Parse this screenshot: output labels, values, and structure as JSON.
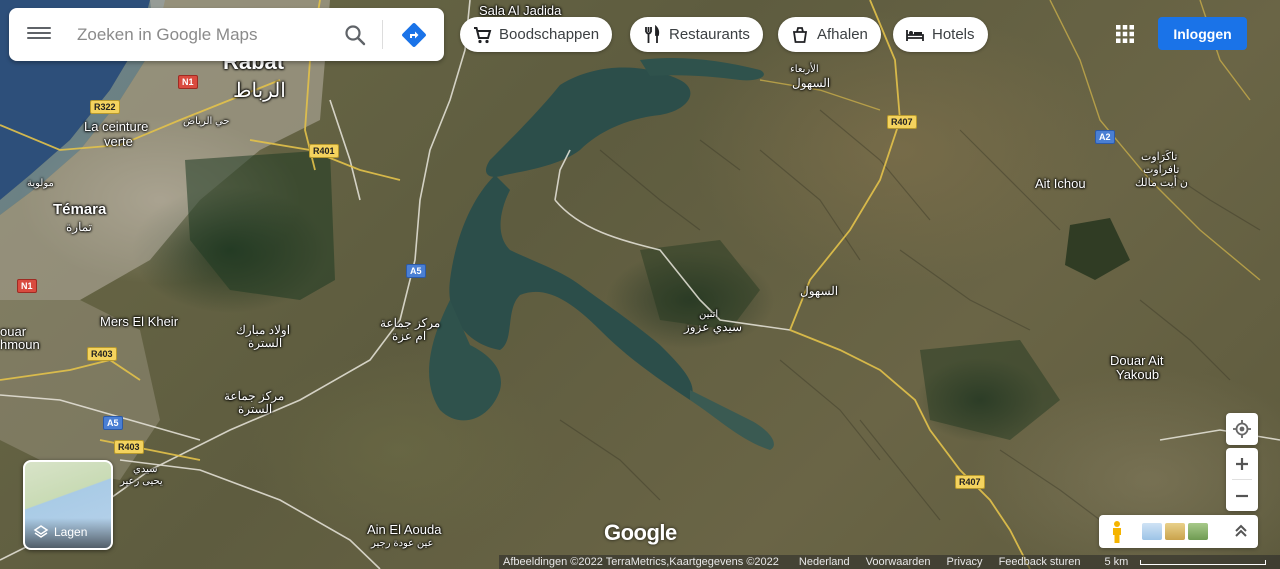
{
  "search": {
    "placeholder": "Zoeken in Google Maps"
  },
  "chips": [
    {
      "label": "Boodschappen",
      "icon": "cart-icon"
    },
    {
      "label": "Restaurants",
      "icon": "fork-knife-icon"
    },
    {
      "label": "Afhalen",
      "icon": "takeout-icon"
    },
    {
      "label": "Hotels",
      "icon": "bed-icon"
    }
  ],
  "login_label": "Inloggen",
  "layers_label": "Lagen",
  "logo": "Google",
  "places": {
    "sala_al_jadida": "Sala Al Jadida",
    "rabat": "Rabat",
    "rabat_ar": "الرباط",
    "la_ceinture": "La ceinture",
    "verte": "verte",
    "hay_riad_ar": "حي الرياض",
    "temara": "Témara",
    "temara_ar": "تمارة",
    "mers_el_kheir": "Mers El Kheir",
    "ouled_mbarek_ar": "اولاد مبارك",
    "ouled_mbarek_ar2": "السترة",
    "markaz_ar": "مركز جماعة",
    "markaz_ar2": "ام عزة",
    "markaz2_ar": "مركز جماعة",
    "markaz2_ar2": "السترة",
    "ain_el_aouda": "Ain El Aouda",
    "ain_el_aouda_ar": "عين عودة رجير",
    "douar_mhoun": "ouar",
    "douar_mhoun2": "hmoun",
    "sidi_yahya_ar": "سيدي",
    "sidi_yahya_ar2": "يحيى زعير",
    "mouhoud_ar": "مولوية",
    "larbaa_ar": "الأربعاء",
    "larbaa_ar2": "السهول",
    "shoul_ar": "السهول",
    "sidi_azzouz_ar": "اتنين",
    "sidi_azzouz_ar2": "سيدي عزوز",
    "ait_ichou": "Ait Ichou",
    "ait_ichou_ar": "تاكَرَاوت",
    "ait_ichou_ar2": "تافراوت",
    "ait_ichou_ar3": "ن أيت مالك",
    "douar_ait": "Douar Ait",
    "yakoub": "Yakoub"
  },
  "roads": {
    "n1_top": "N1",
    "r322": "R322",
    "r401": "R401",
    "a5_mid": "A5",
    "n1_left": "N1",
    "r403_a": "R403",
    "a5_low": "A5",
    "r403_b": "R403",
    "r407_top": "R407",
    "a2": "A2",
    "r407_low": "R407"
  },
  "footer": {
    "attribution": "Afbeeldingen ©2022 TerraMetrics,Kaartgegevens ©2022",
    "country": "Nederland",
    "terms": "Voorwaarden",
    "privacy": "Privacy",
    "feedback": "Feedback sturen",
    "scale": "5 km"
  },
  "colors": {
    "login_blue": "#1a73e8",
    "directions_blue": "#1a73e8",
    "road_shield": "#f4d35e",
    "water": "#2c4e4a"
  }
}
